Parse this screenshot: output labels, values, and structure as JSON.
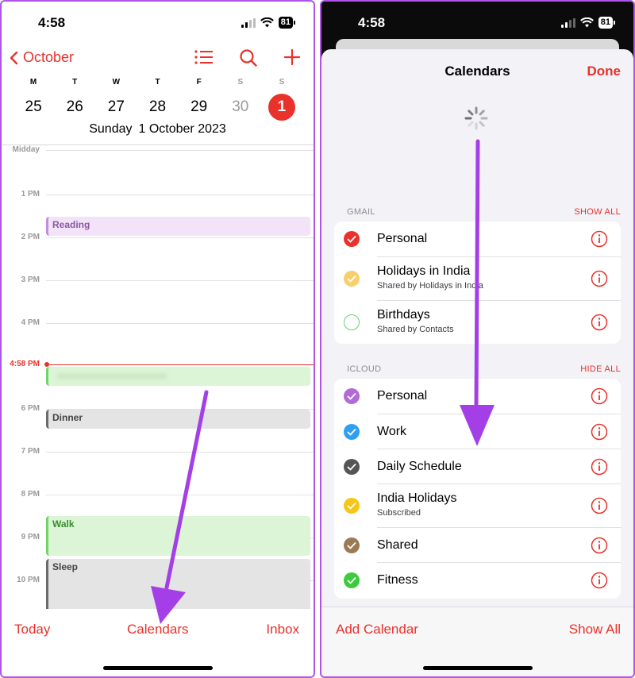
{
  "left": {
    "status": {
      "time": "4:58",
      "battery": "81"
    },
    "nav": {
      "back_label": "October"
    },
    "weekdays": [
      "M",
      "T",
      "W",
      "T",
      "F",
      "S",
      "S"
    ],
    "dates": [
      "25",
      "26",
      "27",
      "28",
      "29",
      "30",
      "1"
    ],
    "selected_day": {
      "weekday": "Sunday",
      "date": "1 October 2023"
    },
    "hours": [
      "Midday",
      "1 PM",
      "2 PM",
      "3 PM",
      "4 PM",
      "6 PM",
      "7 PM",
      "8 PM",
      "9 PM",
      "10 PM"
    ],
    "now_label": "4:58 PM",
    "events": [
      {
        "title": "Reading"
      },
      {
        "title": ""
      },
      {
        "title": "Dinner"
      },
      {
        "title": "Walk"
      },
      {
        "title": "Sleep"
      }
    ],
    "tabbar": {
      "today": "Today",
      "calendars": "Calendars",
      "inbox": "Inbox"
    }
  },
  "right": {
    "status": {
      "time": "4:58",
      "battery": "81"
    },
    "sheet": {
      "title": "Calendars",
      "done": "Done"
    },
    "gmail": {
      "header": "GMAIL",
      "action": "SHOW ALL",
      "items": [
        {
          "name": "Personal",
          "sub": "",
          "color": "#e8322b",
          "checked": true
        },
        {
          "name": "Holidays in India",
          "sub": "Shared by Holidays in India",
          "color": "#f8cf6a",
          "checked": true
        },
        {
          "name": "Birthdays",
          "sub": "Shared by Contacts",
          "color": "#63d16b",
          "checked": false
        }
      ]
    },
    "icloud": {
      "header": "ICLOUD",
      "action": "HIDE ALL",
      "items": [
        {
          "name": "Personal",
          "sub": "",
          "color": "#b36ad6",
          "checked": true
        },
        {
          "name": "Work",
          "sub": "",
          "color": "#2f9ff0",
          "checked": true
        },
        {
          "name": "Daily Schedule",
          "sub": "",
          "color": "#555555",
          "checked": true
        },
        {
          "name": "India Holidays",
          "sub": "Subscribed",
          "color": "#f5c518",
          "checked": true
        },
        {
          "name": "Shared",
          "sub": "",
          "color": "#9b7a56",
          "checked": true
        },
        {
          "name": "Fitness",
          "sub": "",
          "color": "#3ccb3c",
          "checked": true
        }
      ]
    },
    "bottom": {
      "add": "Add Calendar",
      "show": "Show All"
    }
  },
  "accent": "#e8322b",
  "annotation_color": "#a43fe8"
}
